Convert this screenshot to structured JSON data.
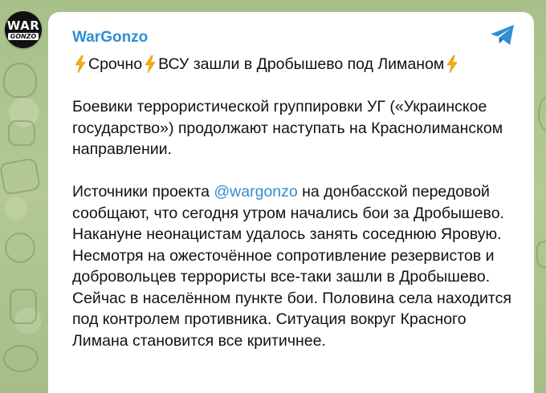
{
  "channel": {
    "name": "WarGonzo",
    "avatar_text_top": "WAR",
    "avatar_text_bottom": "GONZO"
  },
  "message": {
    "headline_prefix": "Срочно",
    "headline_text": "ВСУ зашли в Дробышево под Лиманом",
    "paragraph1": "Боевики террористической группировки УГ («Украинское государство») продолжают наступать на Краснолиманском направлении.",
    "paragraph2_before": "Источники проекта ",
    "paragraph2_mention": "@wargonzo",
    "paragraph2_after": " на донбасской передовой сообщают, что сегодня утром начались бои за Дробышево. Накануне неонацистам удалось занять соседнюю Яровую. Несмотря на ожесточённое сопротивление резервистов и добровольцев террористы все-таки зашли в Дробышево. Сейчас в населённом пункте бои. Половина села находится под контролем противника. Ситуация вокруг Красного Лимана становится все критичнее."
  },
  "icons": {
    "share": "telegram-paper-plane-icon",
    "lightning": "high-voltage-emoji-icon"
  },
  "colors": {
    "channel_name": "#2f8fd0",
    "mention": "#2f8fd0",
    "share_icon": "#2f8fd0",
    "lightning": "#f5b100",
    "wallpaper": "#a9c08a",
    "bubble": "#ffffff"
  }
}
